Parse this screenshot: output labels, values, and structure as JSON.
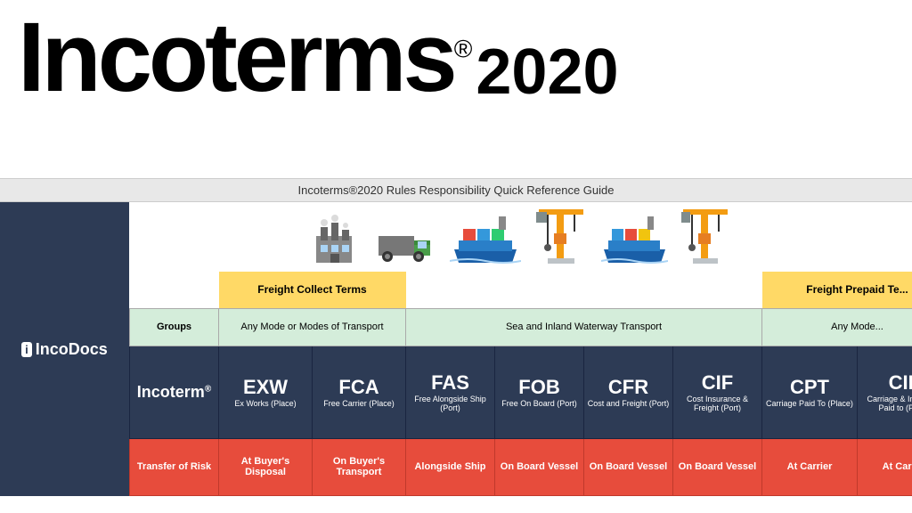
{
  "header": {
    "title": "Incoterms",
    "reg_symbol": "®",
    "year": "2020"
  },
  "subtitle": "Incoterms®2020 Rules Responsibility Quick Reference Guide",
  "logo": {
    "brand": "IncoDocs"
  },
  "freight_headers": {
    "collect_label": "Freight Collect Terms",
    "prepaid_label": "Freight Prepaid Te..."
  },
  "groups_row": {
    "label": "Groups",
    "any_mode": "Any Mode or Modes of Transport",
    "sea_inland": "Sea and Inland Waterway Transport",
    "any_mode_right": "Any Mode..."
  },
  "incoterms": [
    {
      "code": "EXW",
      "desc": "Ex Works (Place)"
    },
    {
      "code": "FCA",
      "desc": "Free Carrier (Place)"
    },
    {
      "code": "FAS",
      "desc": "Free Alongside Ship (Port)"
    },
    {
      "code": "FOB",
      "desc": "Free On Board (Port)"
    },
    {
      "code": "CFR",
      "desc": "Cost and Freight (Port)"
    },
    {
      "code": "CIF",
      "desc": "Cost Insurance & Freight (Port)"
    },
    {
      "code": "CPT",
      "desc": "Carriage Paid To (Place)"
    },
    {
      "code": "CIP",
      "desc": "Carriage & Insurance Paid to (Place)"
    }
  ],
  "incoterm_label": "Incoterm",
  "risk_row": {
    "label": "Transfer of Risk",
    "values": [
      "At Buyer's Disposal",
      "On Buyer's Transport",
      "Alongside Ship",
      "On Board Vessel",
      "On Board Vessel",
      "On Board Vessel",
      "At Carrier",
      "At Carrier"
    ]
  }
}
